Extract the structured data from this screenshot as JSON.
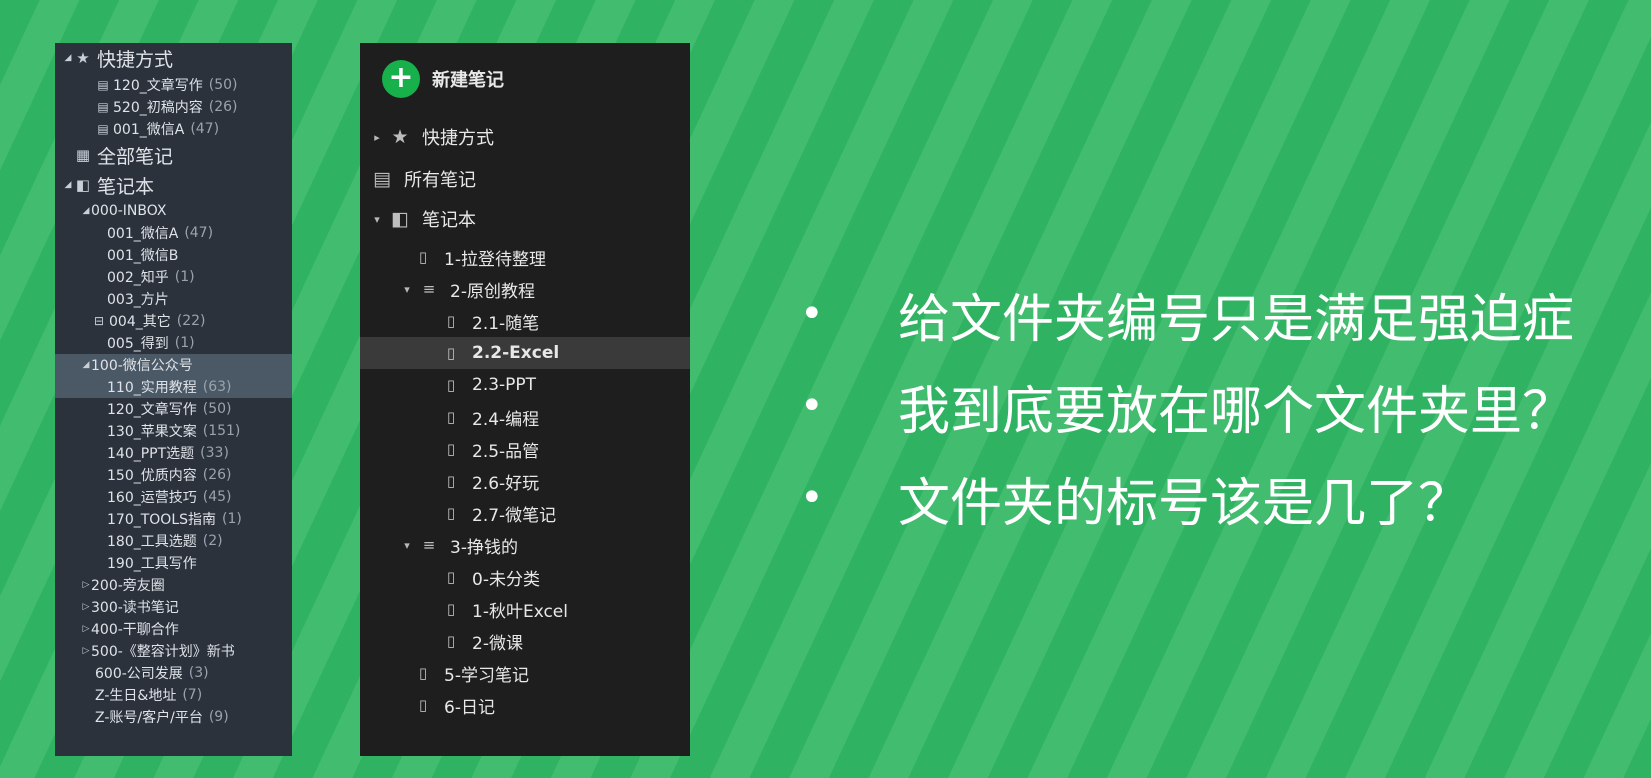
{
  "left_panel": {
    "rows": [
      {
        "tri": "◢",
        "icon": "★",
        "icon_name": "star-icon",
        "label": "快捷方式",
        "count": "",
        "big": true
      },
      {
        "icon": "▤",
        "icon_name": "notebook-icon",
        "label": "120_文章写作",
        "count": "(50)"
      },
      {
        "icon": "▤",
        "icon_name": "notebook-icon",
        "label": "520_初稿内容",
        "count": "(26)"
      },
      {
        "icon": "▤",
        "icon_name": "notebook-icon",
        "label": "001_微信A",
        "count": "(47)"
      },
      {
        "icon": "▦",
        "icon_name": "all-notes-icon",
        "label": "全部笔记",
        "count": "",
        "big": true
      },
      {
        "tri": "◢",
        "icon": "◧",
        "icon_name": "notebooks-icon",
        "label": "笔记本",
        "count": "",
        "big": true
      },
      {
        "tri": "◢",
        "label": "000-INBOX",
        "count": ""
      },
      {
        "label": "001_微信A",
        "count": "(47)"
      },
      {
        "label": "001_微信B",
        "count": ""
      },
      {
        "label": "002_知乎",
        "count": "(1)"
      },
      {
        "label": "003_方片",
        "count": ""
      },
      {
        "icon": "⊟",
        "icon_name": "shared-notebook-icon",
        "label": "004_其它",
        "count": "(22)"
      },
      {
        "label": "005_得到",
        "count": "(1)"
      },
      {
        "tri": "◢",
        "label": "100-微信公众号",
        "count": "",
        "selected": true
      },
      {
        "label": "110_实用教程",
        "count": "(63)",
        "selected": true
      },
      {
        "label": "120_文章写作",
        "count": "(50)"
      },
      {
        "label": "130_苹果文案",
        "count": "(151)"
      },
      {
        "label": "140_PPT选题",
        "count": "(33)"
      },
      {
        "label": "150_优质内容",
        "count": "(26)"
      },
      {
        "label": "160_运营技巧",
        "count": "(45)"
      },
      {
        "label": "170_TOOLS指南",
        "count": "(1)"
      },
      {
        "label": "180_工具选题",
        "count": "(2)"
      },
      {
        "label": "190_工具写作",
        "count": ""
      },
      {
        "tri": "▷",
        "label": "200-旁友圈",
        "count": ""
      },
      {
        "tri": "▷",
        "label": "300-读书笔记",
        "count": ""
      },
      {
        "tri": "▷",
        "label": "400-干聊合作",
        "count": ""
      },
      {
        "tri": "▷",
        "label": "500-《整容计划》新书",
        "count": ""
      },
      {
        "label": "600-公司发展",
        "count": "(3)"
      },
      {
        "label": "Z-生日&地址",
        "count": "(7)"
      },
      {
        "label": "Z-账号/客户/平台",
        "count": "(9)"
      }
    ]
  },
  "right_panel": {
    "new_note_label": "新建笔记",
    "rows": [
      {
        "tri": "▸",
        "icon": "★",
        "icon_name": "star-icon",
        "label": "快捷方式",
        "big": true
      },
      {
        "icon": "▤",
        "icon_name": "all-notes-icon",
        "label": "所有笔记",
        "big": true
      },
      {
        "tri": "▾",
        "icon": "◧",
        "icon_name": "notebooks-icon",
        "label": "笔记本",
        "big": true
      },
      {
        "icon": "▯",
        "icon_name": "notebook-icon",
        "label": "1-拉登待整理"
      },
      {
        "tri": "▾",
        "icon": "≡",
        "icon_name": "stack-icon",
        "label": "2-原创教程"
      },
      {
        "icon": "▯",
        "icon_name": "notebook-icon",
        "label": "2.1-随笔"
      },
      {
        "icon": "▯",
        "icon_name": "notebook-icon",
        "label": "2.2-Excel",
        "selected": true
      },
      {
        "icon": "▯",
        "icon_name": "notebook-icon",
        "label": "2.3-PPT"
      },
      {
        "icon": "▯",
        "icon_name": "notebook-icon",
        "label": "2.4-编程"
      },
      {
        "icon": "▯",
        "icon_name": "notebook-icon",
        "label": "2.5-品管"
      },
      {
        "icon": "▯",
        "icon_name": "notebook-icon",
        "label": "2.6-好玩"
      },
      {
        "icon": "▯",
        "icon_name": "notebook-icon",
        "label": "2.7-微笔记"
      },
      {
        "tri": "▾",
        "icon": "≡",
        "icon_name": "stack-icon",
        "label": "3-挣钱的"
      },
      {
        "icon": "▯",
        "icon_name": "notebook-icon",
        "label": "0-未分类"
      },
      {
        "icon": "▯",
        "icon_name": "notebook-icon",
        "label": "1-秋叶Excel"
      },
      {
        "icon": "▯",
        "icon_name": "notebook-icon",
        "label": "2-微课"
      },
      {
        "icon": "▯",
        "icon_name": "notebook-icon",
        "label": "5-学习笔记"
      },
      {
        "icon": "▯",
        "icon_name": "notebook-icon",
        "label": "6-日记"
      }
    ]
  },
  "bullets": {
    "marker": "•",
    "items": [
      "给文件夹编号只是满足强迫症",
      "我到底要放在哪个文件夹里？",
      "文件夹的标号该是几了？"
    ]
  },
  "colors": {
    "background_stripe_dark": "#2fb262",
    "background_stripe_light": "#42bc6f",
    "left_panel_bg": "#2b323b",
    "right_panel_bg": "#1e1e1e",
    "accent_green": "#17b04a"
  }
}
